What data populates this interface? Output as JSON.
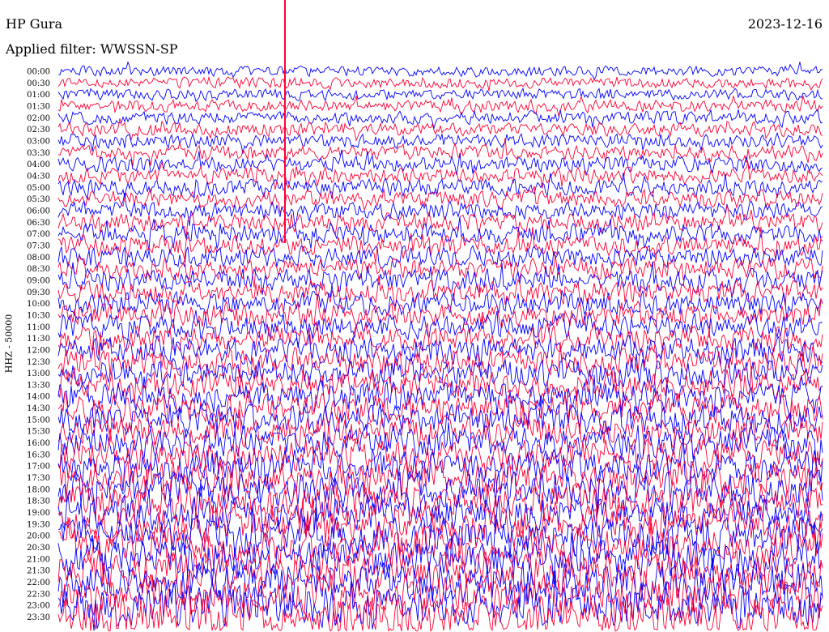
{
  "header": {
    "station": "HP Gura",
    "filter": "Applied filter: WWSSN-SP",
    "date": "2023-12-16"
  },
  "chart_data": {
    "type": "line",
    "ylabel": "HHZ - 50000",
    "row_labels": [
      "00:00",
      "00:30",
      "01:00",
      "01:30",
      "02:00",
      "02:30",
      "03:00",
      "03:30",
      "04:00",
      "04:30",
      "05:00",
      "05:30",
      "06:00",
      "06:30",
      "07:00",
      "07:30",
      "08:00",
      "08:30",
      "09:00",
      "09:30",
      "10:00",
      "10:30",
      "11:00",
      "11:30",
      "12:00",
      "12:30",
      "13:00",
      "13:30",
      "14:00",
      "14:30",
      "15:00",
      "15:30",
      "16:00",
      "16:30",
      "17:00",
      "17:30",
      "18:00",
      "18:30",
      "19:00",
      "19:30",
      "20:00",
      "20:30",
      "21:00",
      "21:30",
      "22:00",
      "22:30",
      "23:00",
      "23:30"
    ],
    "trace_colors": [
      "#0000ff",
      "#ff0033"
    ],
    "marker_color": "#ff0033",
    "grid": false
  }
}
